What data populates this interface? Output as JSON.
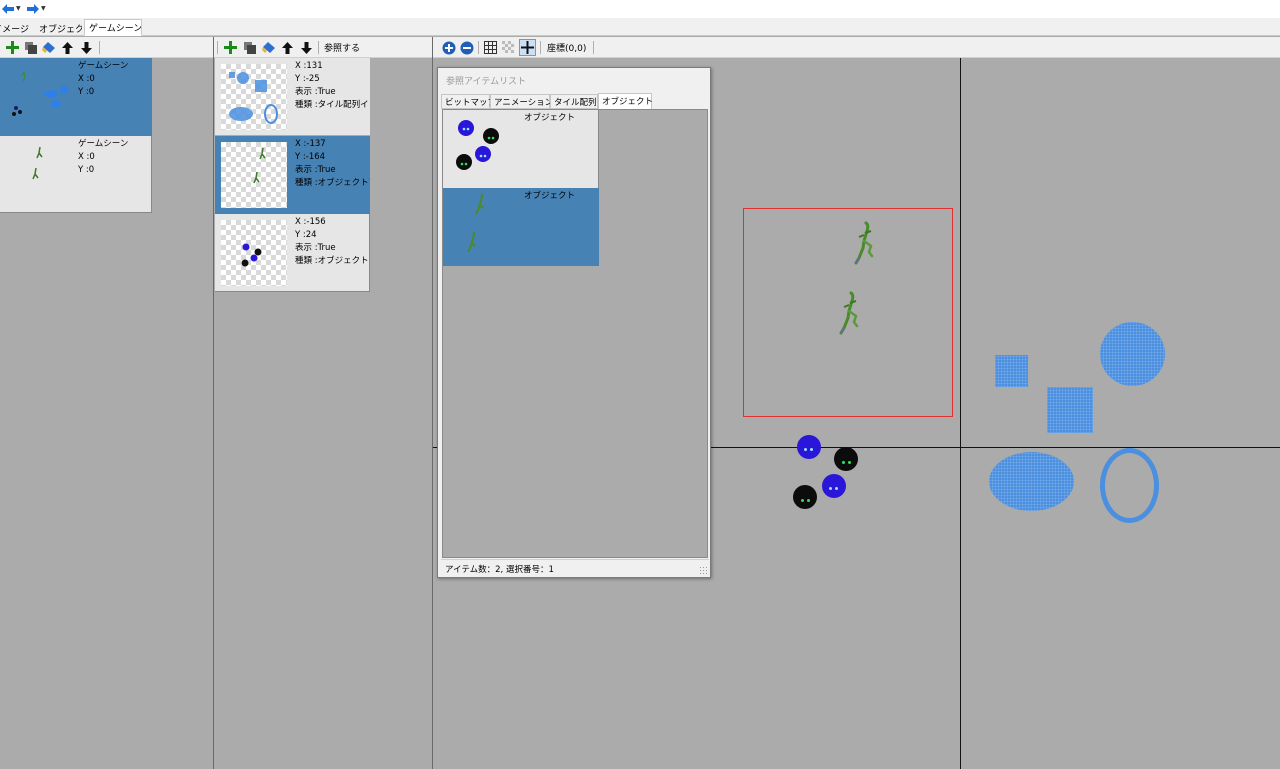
{
  "nav": {
    "back_icon": "arrow-left-icon",
    "forward_icon": "arrow-right-icon"
  },
  "tabs": [
    "イメージ",
    "オブジェクト",
    "ゲームシーン"
  ],
  "active_tab": "ゲームシーン",
  "left_panel": {
    "items": [
      {
        "name": "ゲームシーン",
        "x": "X  :0",
        "y": "Y  :0",
        "selected": true
      },
      {
        "name": "ゲームシーン",
        "x": "X  :0",
        "y": "Y  :0",
        "selected": false
      }
    ]
  },
  "middle_panel": {
    "toolbar": {
      "reference_label": "参照する"
    },
    "items": [
      {
        "x": "X  :131",
        "y": "Y  :-25",
        "display": "表示  :True",
        "kind": "種類  :タイル配列イ",
        "selected": false
      },
      {
        "x": "X  :-137",
        "y": "Y  :-164",
        "display": "表示  :True",
        "kind": "種類  :オブジェクトア",
        "selected": true
      },
      {
        "x": "X  :-156",
        "y": "Y  :24",
        "display": "表示  :True",
        "kind": "種類  :オブジェクトア",
        "selected": false
      }
    ]
  },
  "canvas_toolbar": {
    "coord_label": "座標(0,0)"
  },
  "dialog": {
    "title": "参照アイテムリスト",
    "tabs": [
      "ビットマップ",
      "アニメーション",
      "タイル配列",
      "オブジェクト"
    ],
    "active_tab": "オブジェクト",
    "items": [
      {
        "label": "オブジェクト",
        "selected": false
      },
      {
        "label": "オブジェクト",
        "selected": true
      }
    ],
    "status": "アイテム数：2, 選択番号：1"
  },
  "colors": {
    "selection": "#4682b4",
    "panel_bg": "#ababab",
    "tile_blue": "#4a8fe0",
    "bounding_box": "#e03030"
  }
}
